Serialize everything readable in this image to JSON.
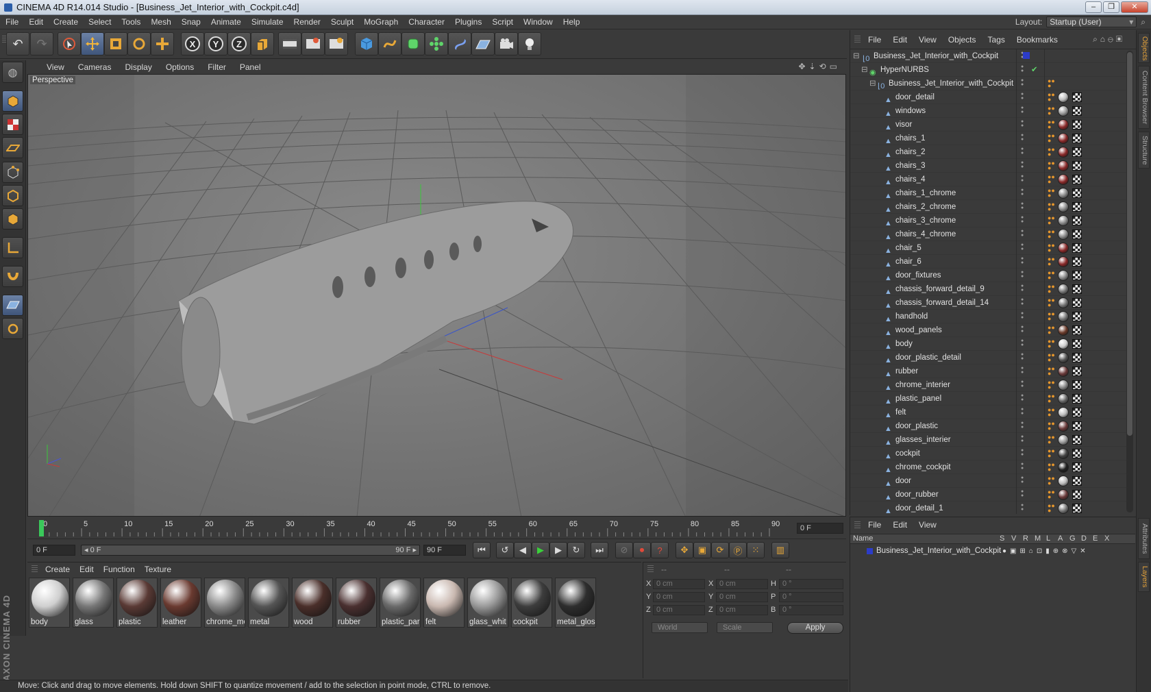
{
  "window": {
    "title": "CINEMA 4D R14.014 Studio - [Business_Jet_Interior_with_Cockpit.c4d]"
  },
  "menubar": [
    "File",
    "Edit",
    "Create",
    "Select",
    "Tools",
    "Mesh",
    "Snap",
    "Animate",
    "Simulate",
    "Render",
    "Sculpt",
    "MoGraph",
    "Character",
    "Plugins",
    "Script",
    "Window",
    "Help"
  ],
  "layout": {
    "label": "Layout:",
    "value": "Startup (User)"
  },
  "toolbar": {
    "icons": [
      "undo-icon",
      "redo-icon",
      "live-select-icon",
      "move-icon",
      "scale-icon",
      "rotate-icon",
      "add-icon",
      "x-axis-icon",
      "y-axis-icon",
      "z-axis-icon",
      "coordinate-system-icon",
      "render-view-icon",
      "render-picture-viewer-icon",
      "render-settings-icon",
      "cube-icon",
      "spline-icon",
      "nurbs-icon",
      "array-icon",
      "deformer-icon",
      "floor-icon",
      "camera-icon",
      "light-icon"
    ]
  },
  "viewport": {
    "menu": [
      "View",
      "Cameras",
      "Display",
      "Options",
      "Filter",
      "Panel"
    ],
    "label": "Perspective"
  },
  "timeline": {
    "ticks": [
      "0",
      "5",
      "10",
      "15",
      "20",
      "25",
      "30",
      "35",
      "40",
      "45",
      "50",
      "55",
      "60",
      "65",
      "70",
      "75",
      "80",
      "85",
      "90"
    ],
    "frame": "0 F"
  },
  "transport": {
    "start": "0 F",
    "range_start": "◂ 0 F",
    "range_end": "90 F ▸",
    "end": "90 F"
  },
  "materials": {
    "menu": [
      "Create",
      "Edit",
      "Function",
      "Texture"
    ],
    "items": [
      {
        "name": "body",
        "color": "#cfcfcf"
      },
      {
        "name": "glass",
        "color": "#777777"
      },
      {
        "name": "plastic",
        "color": "#5a3a35"
      },
      {
        "name": "leather",
        "color": "#6a3a30"
      },
      {
        "name": "chrome_me",
        "color": "#8a8a8a"
      },
      {
        "name": "metal",
        "color": "#555555"
      },
      {
        "name": "wood",
        "color": "#4a2f2a"
      },
      {
        "name": "rubber",
        "color": "#4a3030"
      },
      {
        "name": "plastic_par",
        "color": "#6a6a6a"
      },
      {
        "name": "felt",
        "color": "#c9b8b0"
      },
      {
        "name": "glass_whit",
        "color": "#999999"
      },
      {
        "name": "cockpit",
        "color": "#3d3d3d"
      },
      {
        "name": "metal_glos",
        "color": "#2e2e2e"
      }
    ]
  },
  "coords": {
    "headers": [
      "--",
      "--",
      "--"
    ],
    "rows": [
      {
        "a": "X",
        "av": "0 cm",
        "b": "X",
        "bv": "0 cm",
        "c": "H",
        "cv": "0 °"
      },
      {
        "a": "Y",
        "av": "0 cm",
        "b": "Y",
        "bv": "0 cm",
        "c": "P",
        "cv": "0 °"
      },
      {
        "a": "Z",
        "av": "0 cm",
        "b": "Z",
        "bv": "0 cm",
        "c": "B",
        "cv": "0 °"
      }
    ],
    "space": "World",
    "mode": "Scale",
    "apply": "Apply"
  },
  "status": "Move: Click and drag to move elements. Hold down SHIFT to quantize movement / add to the selection in point mode, CTRL to remove.",
  "objects": {
    "menu": [
      "File",
      "Edit",
      "View",
      "Objects",
      "Tags",
      "Bookmarks"
    ],
    "root": "Business_Jet_Interior_with_Cockpit",
    "hypernurbs": "HyperNURBS",
    "group": "Business_Jet_Interior_with_Cockpit",
    "items": [
      "door_detail",
      "windows",
      "visor",
      "chairs_1",
      "chairs_2",
      "chairs_3",
      "chairs_4",
      "chairs_1_chrome",
      "chairs_2_chrome",
      "chairs_3_chrome",
      "chairs_4_chrome",
      "chair_5",
      "chair_6",
      "door_fixtures",
      "chassis_forward_detail_9",
      "chassis_forward_detail_14",
      "handhold",
      "wood_panels",
      "body",
      "door_plastic_detail",
      "rubber",
      "chrome_interier",
      "plastic_panel",
      "felt",
      "door_plastic",
      "glasses_interier",
      "cockpit",
      "chrome_cockpit",
      "door",
      "door_rubber",
      "door_detail_1"
    ]
  },
  "side_tabs": [
    "Objects",
    "Content Browser",
    "Structure"
  ],
  "side_tabs_lower": [
    "Attributes",
    "Layers"
  ],
  "layers": {
    "menu": [
      "File",
      "Edit",
      "View"
    ],
    "name_header": "Name",
    "cols": [
      "S",
      "V",
      "R",
      "M",
      "L",
      "A",
      "G",
      "D",
      "E",
      "X"
    ],
    "row": "Business_Jet_Interior_with_Cockpit"
  }
}
